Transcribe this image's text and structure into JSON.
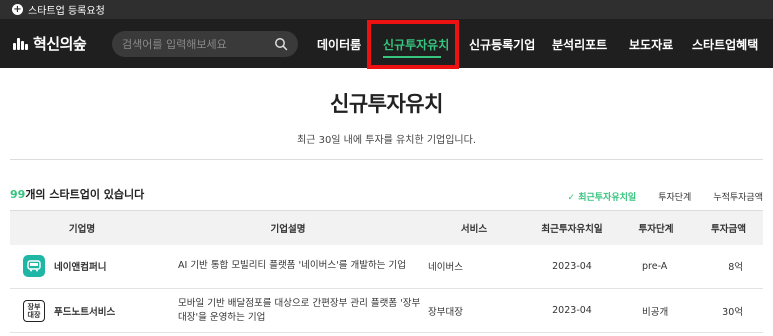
{
  "top_strip": {
    "label": "스타트업 등록요청"
  },
  "header": {
    "logo_text": "혁신의숲",
    "search": {
      "placeholder": "검색어를 입력해보세요"
    },
    "nav": [
      {
        "label": "데이터룸",
        "active": false
      },
      {
        "label": "신규투자유치",
        "active": true
      },
      {
        "label": "신규등록기업",
        "active": false
      },
      {
        "label": "분석리포트",
        "active": false
      },
      {
        "label": "보도자료",
        "active": false
      },
      {
        "label": "스타트업혜택",
        "active": false
      }
    ]
  },
  "hero": {
    "title": "신규투자유치",
    "subtitle": "최근 30일 내에 투자를 유치한 기업입니다."
  },
  "list_summary": {
    "count": "99",
    "suffix": "개의 스타트업이 있습니다"
  },
  "sort_options": [
    {
      "label": "✓ 최근투자유치일",
      "active": true
    },
    {
      "label": "투자단계",
      "active": false
    },
    {
      "label": "누적투자금액",
      "active": false
    }
  ],
  "table": {
    "headers": [
      "기업명",
      "기업설명",
      "서비스",
      "최근투자유치일",
      "투자단계",
      "투자금액"
    ],
    "rows": [
      {
        "company": "네이앤컴퍼니",
        "logo_icon": "nebus-logo-icon",
        "description": "AI 기반 통합 모빌리티 플랫폼 '네이버스'를 개발하는 기업",
        "service": "네이버스",
        "date": "2023-04",
        "stage": "pre-A",
        "amount": "8억"
      },
      {
        "company": "푸드노트서비스",
        "logo_icon": "jangbu-daejang-logo-icon",
        "logo_text": "장부\n대장",
        "description": "모바일 기반 배달점포를 대상으로 간편장부 관리 플랫폼 '장부대장'을 운영하는 기업",
        "service": "장부대장",
        "date": "2023-04",
        "stage": "비공개",
        "amount": "30억"
      }
    ]
  },
  "colors": {
    "accent": "#36c47e",
    "nav_bg": "#1f1f1f",
    "highlight": "#e11111"
  }
}
